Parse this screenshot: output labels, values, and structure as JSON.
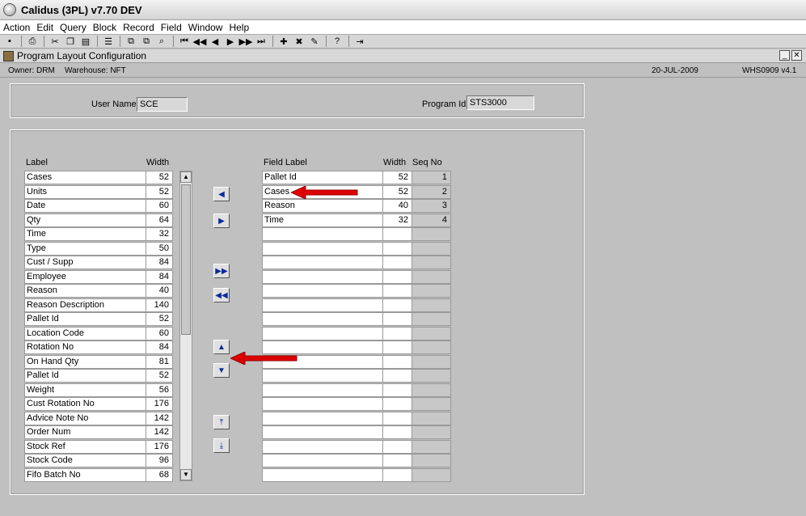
{
  "window": {
    "title": "Calidus (3PL) v7.70 DEV"
  },
  "menu": [
    "Action",
    "Edit",
    "Query",
    "Block",
    "Record",
    "Field",
    "Window",
    "Help"
  ],
  "toolbar": {
    "icons": [
      "save-icon",
      "print-icon",
      "cut-icon",
      "copy-icon",
      "paste-icon",
      "list-icon",
      "clear-icon",
      "duplicate-icon",
      "query-icon",
      "first-record-icon",
      "prev-set-icon",
      "prev-record-icon",
      "next-record-icon",
      "next-set-icon",
      "last-record-icon",
      "insert-record-icon",
      "delete-record-icon",
      "edit-icon",
      "help-icon",
      "exit-icon"
    ]
  },
  "form": {
    "title": "Program Layout Configuration"
  },
  "status": {
    "owner": "Owner:  DRM",
    "warehouse": "Warehouse:  NFT",
    "date": "20-JUL-2009",
    "screen": "WHS0909  v4.1"
  },
  "header": {
    "user_label": "User Name:",
    "user_value": "SCE",
    "program_label": "Program Id:",
    "program_value": "STS3000"
  },
  "left_table": {
    "headers": {
      "label": "Label",
      "width": "Width"
    },
    "rows": [
      {
        "label": "Cases",
        "width": "52"
      },
      {
        "label": "Units",
        "width": "52"
      },
      {
        "label": "Date",
        "width": "60"
      },
      {
        "label": "Qty",
        "width": "64"
      },
      {
        "label": "Time",
        "width": "32"
      },
      {
        "label": "Type",
        "width": "50"
      },
      {
        "label": "Cust / Supp",
        "width": "84"
      },
      {
        "label": "Employee",
        "width": "84"
      },
      {
        "label": "Reason",
        "width": "40"
      },
      {
        "label": "Reason Description",
        "width": "140"
      },
      {
        "label": "Pallet Id",
        "width": "52"
      },
      {
        "label": "Location Code",
        "width": "60"
      },
      {
        "label": "Rotation No",
        "width": "84"
      },
      {
        "label": "On Hand Qty",
        "width": "81"
      },
      {
        "label": "Pallet Id",
        "width": "52"
      },
      {
        "label": "Weight",
        "width": "56"
      },
      {
        "label": "Cust Rotation No",
        "width": "176"
      },
      {
        "label": "Advice Note No",
        "width": "142"
      },
      {
        "label": "Order Num",
        "width": "142"
      },
      {
        "label": "Stock Ref",
        "width": "176"
      },
      {
        "label": "Stock Code",
        "width": "96"
      },
      {
        "label": "Fifo Batch No",
        "width": "68"
      }
    ]
  },
  "right_table": {
    "headers": {
      "field_label": "Field Label",
      "width": "Width",
      "seq": "Seq No"
    },
    "rows": [
      {
        "field_label": "Pallet Id",
        "width": "52",
        "seq": "1"
      },
      {
        "field_label": "Cases",
        "width": "52",
        "seq": "2"
      },
      {
        "field_label": "Reason",
        "width": "40",
        "seq": "3"
      },
      {
        "field_label": "Time",
        "width": "32",
        "seq": "4"
      },
      {
        "field_label": "",
        "width": "",
        "seq": ""
      },
      {
        "field_label": "",
        "width": "",
        "seq": ""
      },
      {
        "field_label": "",
        "width": "",
        "seq": ""
      },
      {
        "field_label": "",
        "width": "",
        "seq": ""
      },
      {
        "field_label": "",
        "width": "",
        "seq": ""
      },
      {
        "field_label": "",
        "width": "",
        "seq": ""
      },
      {
        "field_label": "",
        "width": "",
        "seq": ""
      },
      {
        "field_label": "",
        "width": "",
        "seq": ""
      },
      {
        "field_label": "",
        "width": "",
        "seq": ""
      },
      {
        "field_label": "",
        "width": "",
        "seq": ""
      },
      {
        "field_label": "",
        "width": "",
        "seq": ""
      },
      {
        "field_label": "",
        "width": "",
        "seq": ""
      },
      {
        "field_label": "",
        "width": "",
        "seq": ""
      },
      {
        "field_label": "",
        "width": "",
        "seq": ""
      },
      {
        "field_label": "",
        "width": "",
        "seq": ""
      },
      {
        "field_label": "",
        "width": "",
        "seq": ""
      },
      {
        "field_label": "",
        "width": "",
        "seq": ""
      },
      {
        "field_label": "",
        "width": "",
        "seq": ""
      }
    ]
  },
  "nav_buttons": [
    "move-left-icon",
    "move-right-icon",
    "move-all-right-icon",
    "move-all-left-icon",
    "move-up-icon",
    "move-down-icon",
    "move-top-icon",
    "move-bottom-icon"
  ],
  "colors": {
    "arrow": "#dd0000",
    "button_glyph": "#0a2a9a"
  }
}
